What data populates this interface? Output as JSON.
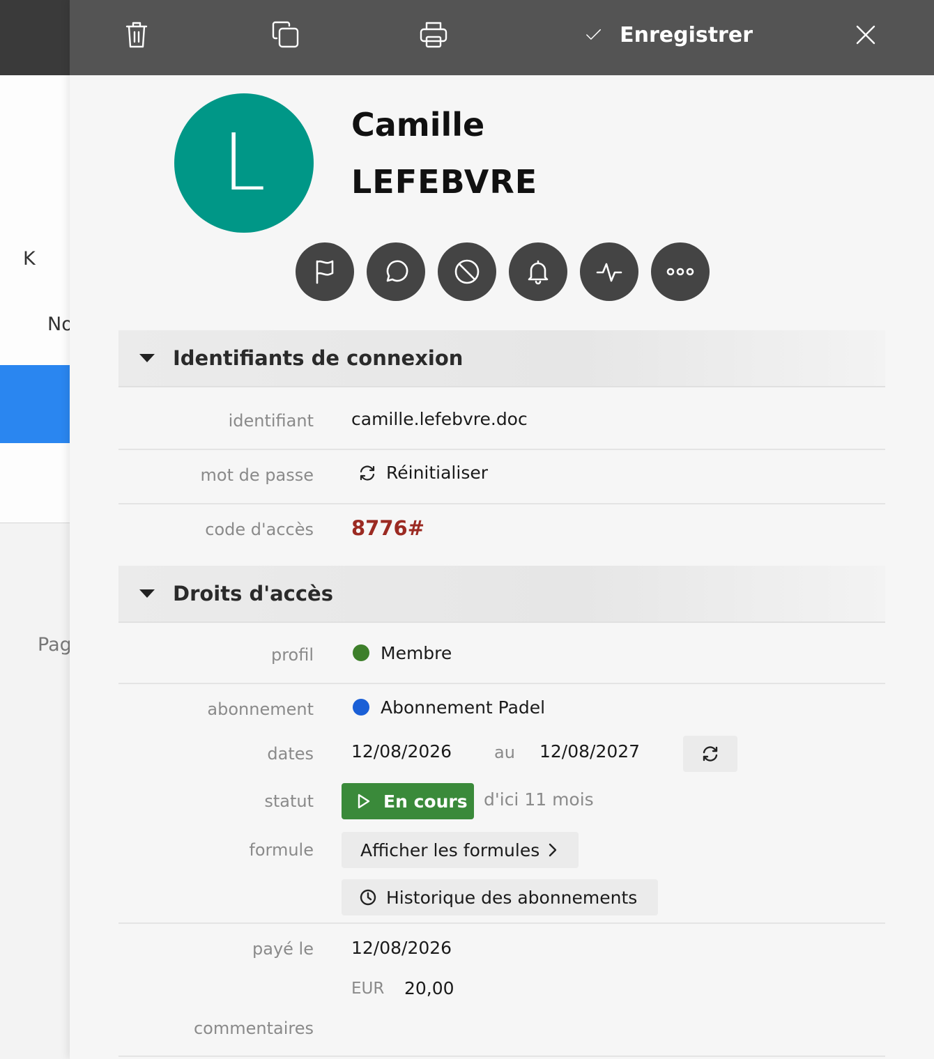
{
  "background": {
    "letter_k": "K",
    "text_no": "No",
    "text_pag": "Pag"
  },
  "toolbar": {
    "save_label": "Enregistrer"
  },
  "person": {
    "initial": "L",
    "first_name": "Camille",
    "last_name": "LEFEBVRE",
    "avatar_color": "#009787"
  },
  "sections": {
    "login": {
      "title": "Identifiants de connexion",
      "identifier_label": "identifiant",
      "identifier_value": "camille.lefebvre.doc",
      "password_label": "mot de passe",
      "reset_label": "Réinitialiser",
      "access_code_label": "code d'accès",
      "access_code_value": "8776#"
    },
    "rights": {
      "title": "Droits d'accès",
      "profile_label": "profil",
      "profile_value": "Membre",
      "profile_color": "#3d7f2a",
      "subscription_label": "abonnement",
      "subscription_value": "Abonnement Padel",
      "subscription_color": "#1a5fd6",
      "dates_label": "dates",
      "date_start": "12/08/2026",
      "date_sep": "au",
      "date_end": "12/08/2027",
      "status_label": "statut",
      "status_value": "En cours",
      "status_color": "#3a8a3a",
      "status_note": "d'ici 11 mois",
      "formula_label": "formule",
      "formula_button": "Afficher les formules",
      "history_button": "Historique des abonnements",
      "paid_label": "payé le",
      "paid_date": "12/08/2026",
      "currency": "EUR",
      "amount": "20,00",
      "comments_label": "commentaires"
    }
  }
}
